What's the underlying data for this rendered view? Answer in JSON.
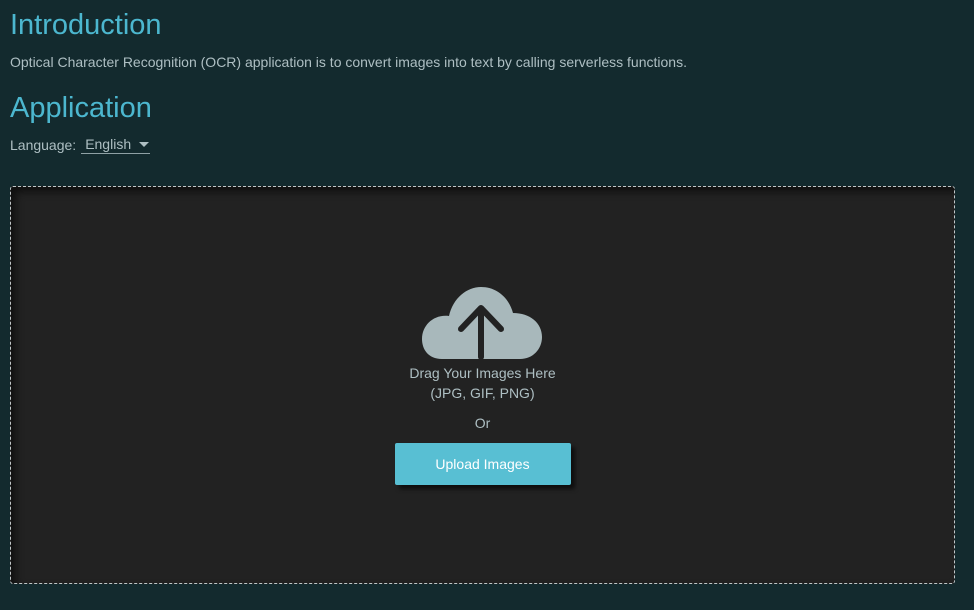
{
  "intro": {
    "title": "Introduction",
    "text": "Optical Character Recognition (OCR) application is to convert images into text by calling serverless functions."
  },
  "application": {
    "title": "Application",
    "language_label": "Language:",
    "language_value": "English"
  },
  "dropzone": {
    "icon": "cloud-upload-icon",
    "drag_text": "Drag Your Images Here",
    "formats_text": "(JPG, GIF, PNG)",
    "or_text": "Or",
    "upload_label": "Upload Images"
  },
  "colors": {
    "background": "#132a2e",
    "accent": "#4cb7cf",
    "dropzone_background": "#222222",
    "button": "#58bfd3"
  }
}
